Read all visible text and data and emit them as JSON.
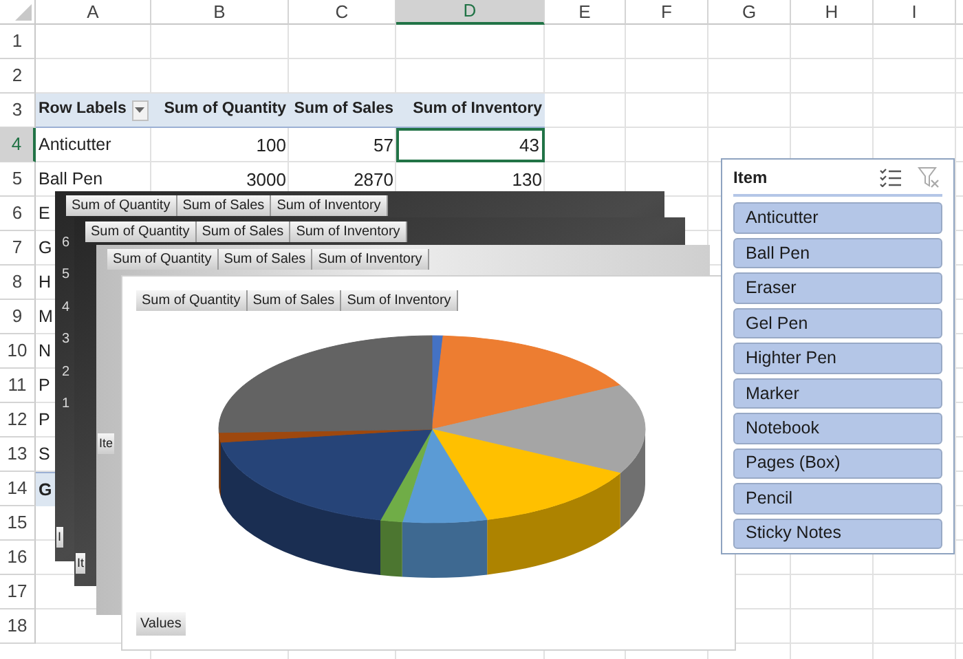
{
  "sheet": {
    "columns": [
      {
        "label": "A",
        "selected": false
      },
      {
        "label": "B",
        "selected": false
      },
      {
        "label": "C",
        "selected": false
      },
      {
        "label": "D",
        "selected": true
      },
      {
        "label": "E",
        "selected": false
      },
      {
        "label": "F",
        "selected": false
      },
      {
        "label": "G",
        "selected": false
      },
      {
        "label": "H",
        "selected": false
      },
      {
        "label": "I",
        "selected": false
      }
    ],
    "row_numbers": [
      {
        "label": "1",
        "selected": false
      },
      {
        "label": "2",
        "selected": false
      },
      {
        "label": "3",
        "selected": false
      },
      {
        "label": "4",
        "selected": true
      },
      {
        "label": "5",
        "selected": false
      },
      {
        "label": "6",
        "selected": false
      },
      {
        "label": "7",
        "selected": false
      },
      {
        "label": "8",
        "selected": false
      },
      {
        "label": "9",
        "selected": false
      },
      {
        "label": "10",
        "selected": false
      },
      {
        "label": "11",
        "selected": false
      },
      {
        "label": "12",
        "selected": false
      },
      {
        "label": "13",
        "selected": false
      },
      {
        "label": "14",
        "selected": false
      },
      {
        "label": "15",
        "selected": false
      },
      {
        "label": "16",
        "selected": false
      },
      {
        "label": "17",
        "selected": false
      },
      {
        "label": "18",
        "selected": false
      }
    ],
    "pivot_table": {
      "headers": [
        "Row Labels",
        "Sum of Quantity",
        "Sum of Sales",
        "Sum of Inventory"
      ],
      "rows": [
        {
          "kind": "item",
          "label": "Anticutter",
          "values": [
            {
              "text": "100",
              "selected": false
            },
            {
              "text": "57",
              "selected": false
            },
            {
              "text": "43",
              "selected": true
            }
          ]
        },
        {
          "kind": "item",
          "label": "Ball Pen",
          "values": [
            {
              "text": "3000",
              "selected": false
            },
            {
              "text": "2870",
              "selected": false
            },
            {
              "text": "130",
              "selected": false
            }
          ]
        },
        {
          "kind": "item",
          "label": "E"
        },
        {
          "kind": "item",
          "label": "G"
        },
        {
          "kind": "item",
          "label": "H"
        },
        {
          "kind": "item",
          "label": "M"
        },
        {
          "kind": "item",
          "label": "N"
        },
        {
          "kind": "item",
          "label": "P"
        },
        {
          "kind": "item",
          "label": "P"
        },
        {
          "kind": "item",
          "label": "S"
        },
        {
          "kind": "total",
          "label": "G"
        }
      ]
    }
  },
  "charts": [
    {
      "kind": "dark",
      "field_buttons": [
        "Sum of Quantity",
        "Sum of Sales",
        "Sum of Inventory"
      ],
      "axis_labels": [
        "6",
        "5",
        "4",
        "3",
        "2",
        "1"
      ],
      "axis_button": "I"
    },
    {
      "kind": "dark",
      "field_buttons": [
        "Sum of Quantity",
        "Sum of Sales",
        "Sum of Inventory"
      ],
      "axis_button": "It"
    },
    {
      "kind": "light",
      "field_buttons": [
        "Sum of Quantity",
        "Sum of Sales",
        "Sum of Inventory"
      ],
      "axis_button": "Ite"
    },
    {
      "kind": "white",
      "field_buttons": [
        "Sum of Quantity",
        "Sum of Sales",
        "Sum of Inventory"
      ],
      "values_button": "Values",
      "pie": true
    }
  ],
  "slicer": {
    "title": "Item",
    "items": [
      {
        "label": "Anticutter",
        "selected": true
      },
      {
        "label": "Ball Pen",
        "selected": true
      },
      {
        "label": "Eraser",
        "selected": true
      },
      {
        "label": "Gel Pen",
        "selected": true
      },
      {
        "label": "Highter Pen",
        "selected": true
      },
      {
        "label": "Marker",
        "selected": true
      },
      {
        "label": "Notebook",
        "selected": true
      },
      {
        "label": "Pages (Box)",
        "selected": true
      },
      {
        "label": "Pencil",
        "selected": true
      },
      {
        "label": "Sticky Notes",
        "selected": true
      }
    ]
  }
}
